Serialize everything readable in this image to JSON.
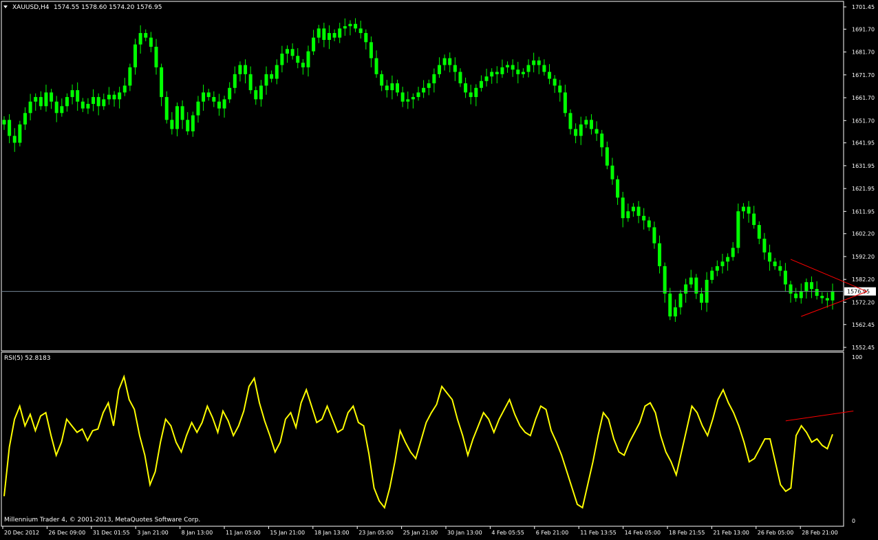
{
  "window": {
    "symbol_title": "XAUUSD,H4",
    "ohlc_readout": "1574.55  1578.60  1574.20  1576.95",
    "footer_text": "Millennium Trader 4, © 2001-2013, MetaQuotes Software Corp."
  },
  "colors": {
    "background": "#000000",
    "frame": "#ffffff",
    "candle": "#00ff00",
    "rsi_line": "#ffff00",
    "trendline": "#ff0000",
    "bid_line": "#778899",
    "text": "#ffffff"
  },
  "chart_data": [
    {
      "type": "line",
      "title": "XAUUSD,H4",
      "price_ticks": [
        "1701.45",
        "1691.70",
        "1681.70",
        "1671.70",
        "1661.70",
        "1651.70",
        "1641.95",
        "1631.95",
        "1621.95",
        "1611.95",
        "1602.20",
        "1592.20",
        "1582.20",
        "1572.20",
        "1562.45",
        "1552.45"
      ],
      "ylim": [
        1552.45,
        1701.45
      ],
      "current_price": 1576.95,
      "current_price_label": "1576.95",
      "series": [
        {
          "values": [
            1652,
            1645,
            1642,
            1650,
            1655,
            1660,
            1662,
            1658,
            1664,
            1660,
            1655,
            1658,
            1662,
            1665,
            1660,
            1657,
            1659,
            1662,
            1658,
            1661,
            1663,
            1661,
            1664,
            1667,
            1675,
            1685,
            1690,
            1688,
            1684,
            1675,
            1662,
            1652,
            1648,
            1658,
            1652,
            1647,
            1654,
            1660,
            1664,
            1662,
            1660,
            1657,
            1661,
            1666,
            1672,
            1676,
            1672,
            1665,
            1661,
            1667,
            1672,
            1670,
            1676,
            1681,
            1683,
            1680,
            1677,
            1675,
            1682,
            1688,
            1692,
            1687,
            1690,
            1688,
            1692,
            1693,
            1694,
            1692,
            1690,
            1686,
            1679,
            1672,
            1667,
            1665,
            1668,
            1664,
            1660,
            1661,
            1662,
            1664,
            1666,
            1668,
            1672,
            1676,
            1679,
            1676,
            1673,
            1668,
            1664,
            1662,
            1666,
            1669,
            1671,
            1673,
            1672,
            1675,
            1676,
            1674,
            1672,
            1673,
            1676,
            1678,
            1676,
            1673,
            1670,
            1667,
            1664,
            1655,
            1648,
            1645,
            1650,
            1652,
            1648,
            1646,
            1640,
            1632,
            1626,
            1618,
            1609,
            1612,
            1614,
            1610,
            1608,
            1605,
            1598,
            1588,
            1576,
            1566,
            1570,
            1576,
            1580,
            1583,
            1576,
            1572,
            1582,
            1586,
            1588,
            1590,
            1592,
            1596,
            1612,
            1614,
            1611,
            1606,
            1600,
            1594,
            1590,
            1588,
            1586,
            1580,
            1576,
            1574,
            1577,
            1581,
            1578,
            1575,
            1574,
            1573,
            1576.95
          ]
        }
      ],
      "trendlines": [
        {
          "x1": 150,
          "y1": 1591,
          "x2": 163,
          "y2": 1576.9
        },
        {
          "x1": 152,
          "y1": 1566,
          "x2": 163,
          "y2": 1576.9
        }
      ]
    },
    {
      "type": "line",
      "title": "RSI(5) 52.8183",
      "ylim": [
        0,
        100
      ],
      "tick_labels": [
        "100",
        "0"
      ],
      "series": [
        {
          "values": [
            15,
            45,
            62,
            70,
            58,
            65,
            55,
            64,
            66,
            52,
            40,
            48,
            62,
            58,
            54,
            56,
            49,
            55,
            56,
            66,
            72,
            58,
            80,
            88,
            74,
            68,
            52,
            40,
            22,
            30,
            48,
            62,
            58,
            48,
            42,
            52,
            60,
            54,
            60,
            70,
            63,
            54,
            67,
            61,
            52,
            58,
            67,
            82,
            87,
            72,
            61,
            52,
            42,
            48,
            62,
            66,
            57,
            72,
            80,
            70,
            60,
            62,
            70,
            62,
            54,
            56,
            66,
            70,
            60,
            58,
            41,
            20,
            12,
            8,
            20,
            36,
            55,
            48,
            42,
            38,
            49,
            60,
            66,
            71,
            82,
            78,
            74,
            62,
            52,
            40,
            50,
            58,
            66,
            62,
            54,
            62,
            68,
            74,
            65,
            58,
            54,
            52,
            62,
            70,
            68,
            55,
            48,
            40,
            30,
            20,
            10,
            8,
            22,
            36,
            52,
            66,
            62,
            50,
            42,
            40,
            48,
            54,
            60,
            70,
            72,
            66,
            52,
            42,
            36,
            28,
            42,
            56,
            70,
            66,
            58,
            52,
            62,
            74,
            80,
            72,
            66,
            58,
            48,
            36,
            38,
            44,
            50,
            50,
            36,
            22,
            18,
            20,
            52,
            58,
            54,
            48,
            50,
            46,
            44,
            52.8
          ]
        }
      ],
      "trendlines": [
        {
          "x1": 150,
          "y1": 61,
          "x2": 163,
          "y2": 67
        }
      ]
    }
  ],
  "time_axis": [
    "20 Dec 2012",
    "26 Dec 09:00",
    "31 Dec 01:55",
    "3 Jan 21:00",
    "8 Jan 13:00",
    "11 Jan 05:00",
    "15 Jan 21:00",
    "18 Jan 13:00",
    "23 Jan 05:00",
    "25 Jan 21:00",
    "30 Jan 13:00",
    "4 Feb 05:55",
    "6 Feb 21:00",
    "11 Feb 13:55",
    "14 Feb 05:00",
    "18 Feb 21:55",
    "21 Feb 13:00",
    "26 Feb 05:00",
    "28 Feb 21:00"
  ]
}
